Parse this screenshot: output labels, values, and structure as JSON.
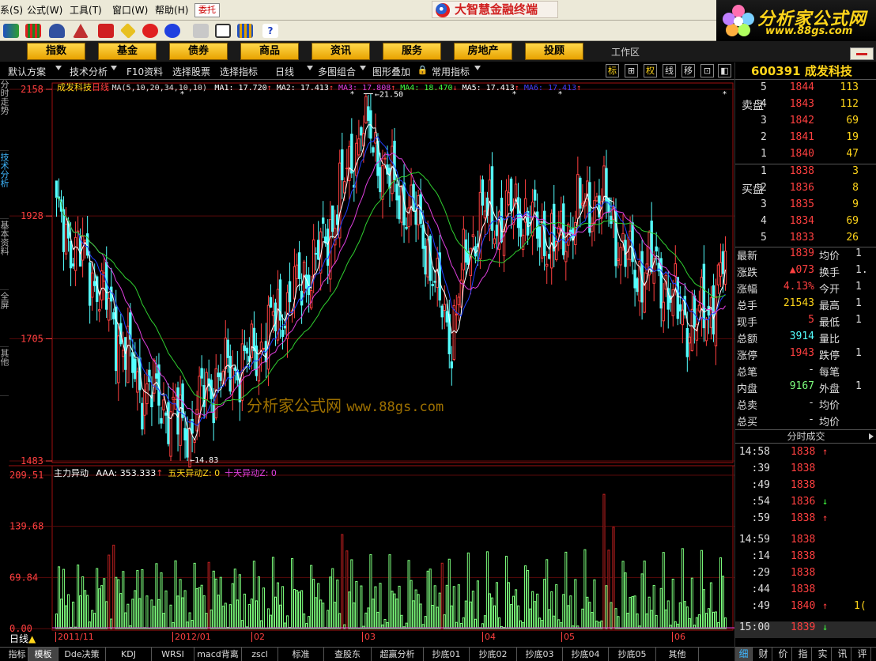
{
  "menu": {
    "items": [
      "系",
      "公式",
      "工具",
      "窗口",
      "帮助"
    ],
    "shortcuts": [
      "S",
      "(W)",
      "(T)",
      "(W)",
      "(H)"
    ],
    "order_button": "委托",
    "app_title": "大智慧金融终端"
  },
  "brand": {
    "name": "分析家公式网",
    "url": "www.88gs.com"
  },
  "nav": {
    "tabs": [
      "指数",
      "基金",
      "债券",
      "商品",
      "资讯",
      "服务",
      "房地产",
      "投顾"
    ],
    "workarea": "工作区"
  },
  "subbar": {
    "items": [
      "默认方案",
      "技术分析",
      "F10资料",
      "选择股票",
      "选择指标",
      "日线",
      "多图组合",
      "图形叠加",
      "常用指标"
    ],
    "right_buttons": [
      "标",
      "⊞",
      "权",
      "线",
      "移",
      "⊡",
      "◧"
    ]
  },
  "leftstrip": {
    "items": [
      "分时走势",
      "技术分析",
      "基本资料",
      "全屏",
      "其他"
    ]
  },
  "chart": {
    "stock_name": "成发科技",
    "period": "日线",
    "ma_params": "MA(5,10,20,34,10,10)",
    "ma_values": [
      {
        "label": "MA1:",
        "value": "17.720",
        "arrow": "↑",
        "color": "#ffffff"
      },
      {
        "label": "MA2:",
        "value": "17.413",
        "arrow": "↑",
        "color": "#ffffff"
      },
      {
        "label": "MA3:",
        "value": "17.808",
        "arrow": "↑",
        "color": "#e040e0"
      },
      {
        "label": "MA4:",
        "value": "18.470",
        "arrow": "↓",
        "color": "#40ff40"
      },
      {
        "label": "MA5:",
        "value": "17.413",
        "arrow": "↑",
        "color": "#ffffff"
      },
      {
        "label": "MA6:",
        "value": "17.413",
        "arrow": "↑",
        "color": "#4040ff"
      }
    ],
    "price_axis": {
      "labels": [
        "2158",
        "1928",
        "1705",
        "1483"
      ],
      "values": [
        21.58,
        19.28,
        17.05,
        14.83
      ]
    },
    "high_marker": "21.50",
    "low_marker": "14.83",
    "indicator_title": "主力异动",
    "indicator_values": [
      {
        "label": "AAA:",
        "value": "353.333",
        "arrow": "↑",
        "color": "#ffffff"
      },
      {
        "label": "五天异动Z:",
        "value": "0",
        "arrow": "",
        "color": "#ffd51a"
      },
      {
        "label": "十天异动Z:",
        "value": "0",
        "arrow": "",
        "color": "#e040e0"
      }
    ],
    "indicator_axis": {
      "labels": [
        "209.51",
        "139.68",
        "69.84",
        "0.00"
      ],
      "values": [
        209.51,
        139.68,
        69.84,
        0
      ]
    },
    "x_labels": [
      "2011/11",
      "2012/01",
      "02",
      "03",
      "04",
      "05",
      "06"
    ],
    "watermark": "分析家公式网",
    "watermark_url": "www.88gs.com",
    "colors": {
      "up": "#ff4040",
      "down": "#54ffff",
      "ma_white": "#ffffff",
      "ma_blue": "#2040ff",
      "ma_magenta": "#e040e0",
      "ma_green": "#30d030",
      "bar_green": "#7dff7d",
      "bar_red": "#c02020"
    }
  },
  "bottom_tabs": [
    "指标",
    "模板",
    "Dde决策",
    "KDJ",
    "WRSI",
    "macd背离",
    "zscl",
    "标准",
    "查股东",
    "超赢分析",
    "抄底01",
    "抄底02",
    "抄底03",
    "抄底04",
    "抄底05",
    "其他"
  ],
  "panel": {
    "code": "600391",
    "name": "成发科技",
    "sell_side": "卖盘",
    "buy_side": "买盘",
    "asks": [
      {
        "lvl": "5",
        "price": "1844",
        "vol": "113"
      },
      {
        "lvl": "4",
        "price": "1843",
        "vol": "112"
      },
      {
        "lvl": "3",
        "price": "1842",
        "vol": "69"
      },
      {
        "lvl": "2",
        "price": "1841",
        "vol": "19"
      },
      {
        "lvl": "1",
        "price": "1840",
        "vol": "47"
      }
    ],
    "bids": [
      {
        "lvl": "1",
        "price": "1838",
        "vol": "3"
      },
      {
        "lvl": "2",
        "price": "1836",
        "vol": "8"
      },
      {
        "lvl": "3",
        "price": "1835",
        "vol": "9"
      },
      {
        "lvl": "4",
        "price": "1834",
        "vol": "69"
      },
      {
        "lvl": "5",
        "price": "1833",
        "vol": "26"
      }
    ],
    "quotes": [
      {
        "k1": "最新",
        "v1": "1839",
        "c1": "#ff4040",
        "k2": "均价",
        "v2": "1"
      },
      {
        "k1": "涨跌",
        "v1": "▲073",
        "c1": "#ff4040",
        "k2": "换手",
        "v2": "1."
      },
      {
        "k1": "涨幅",
        "v1": "4.13%",
        "c1": "#ff4040",
        "k2": "今开",
        "v2": "1"
      },
      {
        "k1": "总手",
        "v1": "21543",
        "c1": "#ffd51a",
        "k2": "最高",
        "v2": "1"
      },
      {
        "k1": "现手",
        "v1": "5",
        "c1": "#ff4040",
        "k2": "最低",
        "v2": "1"
      },
      {
        "k1": "总额",
        "v1": "3914",
        "c1": "#54ffff",
        "k2": "量比",
        "v2": ""
      },
      {
        "k1": "涨停",
        "v1": "1943",
        "c1": "#ff4040",
        "k2": "跌停",
        "v2": "1"
      },
      {
        "k1": "总笔",
        "v1": "-",
        "c1": "#ddd",
        "k2": "每笔",
        "v2": ""
      },
      {
        "k1": "内盘",
        "v1": "9167",
        "c1": "#7dff7d",
        "k2": "外盘",
        "v2": "1"
      },
      {
        "k1": "总卖",
        "v1": "-",
        "c1": "#ddd",
        "k2": "均价",
        "v2": ""
      },
      {
        "k1": "总买",
        "v1": "-",
        "c1": "#ddd",
        "k2": "均价",
        "v2": ""
      }
    ],
    "tick_tab": "分时成交",
    "ticks": [
      {
        "t": "14:58",
        "p": "1838",
        "ud": "↑",
        "c": "#ff4040",
        "q": ""
      },
      {
        "t": ":39",
        "p": "1838",
        "ud": "",
        "c": "#ff4040",
        "q": ""
      },
      {
        "t": ":49",
        "p": "1838",
        "ud": "",
        "c": "#ff4040",
        "q": ""
      },
      {
        "t": ":54",
        "p": "1836",
        "ud": "↓",
        "c": "#40ff40",
        "q": ""
      },
      {
        "t": ":59",
        "p": "1838",
        "ud": "↑",
        "c": "#ff4040",
        "q": ""
      },
      {
        "t": "14:59",
        "p": "1838",
        "ud": "",
        "c": "#ff4040",
        "q": ""
      },
      {
        "t": ":14",
        "p": "1838",
        "ud": "",
        "c": "#ff4040",
        "q": ""
      },
      {
        "t": ":29",
        "p": "1838",
        "ud": "",
        "c": "#ff4040",
        "q": ""
      },
      {
        "t": ":44",
        "p": "1838",
        "ud": "",
        "c": "#ff4040",
        "q": ""
      },
      {
        "t": ":49",
        "p": "1840",
        "ud": "↑",
        "c": "#ff4040",
        "q": "1("
      },
      {
        "t": "15:00",
        "p": "1839",
        "ud": "↓",
        "c": "#40ff40",
        "q": ""
      }
    ],
    "right_tabs": [
      "细",
      "财",
      "价",
      "指",
      "实",
      "讯",
      "评"
    ]
  }
}
